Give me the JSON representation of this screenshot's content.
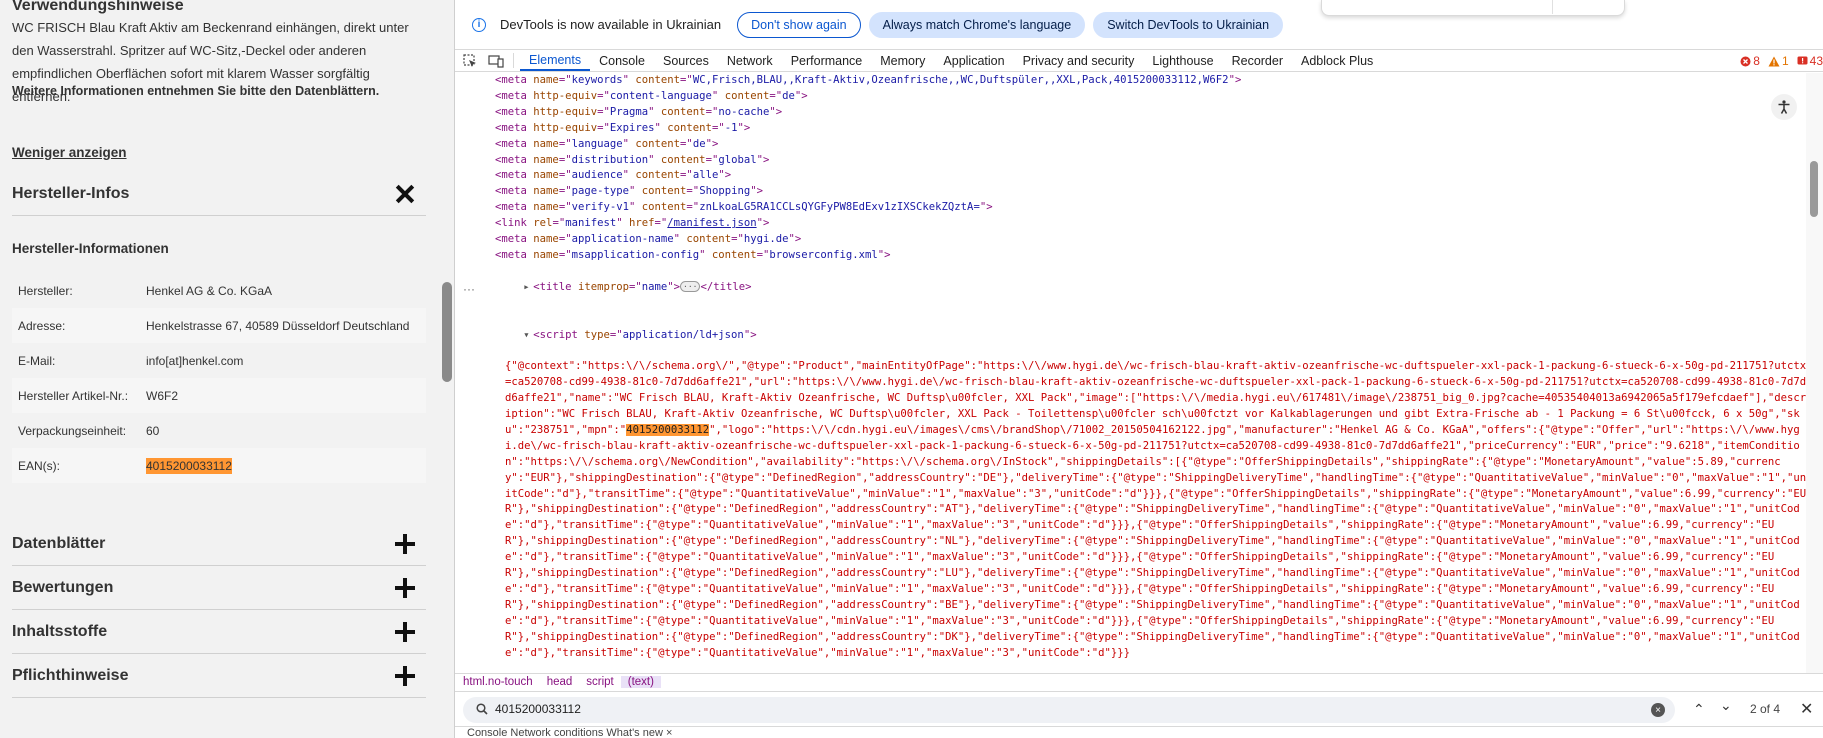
{
  "page": {
    "usage_heading": "Verwendungshinweise",
    "usage_text": "WC FRISCH Blau Kraft Aktiv am Beckenrand einhängen, direkt unter den Wasserstrahl. Spritzer auf WC-Sitz,-Deckel oder anderen empfindlichen Oberflächen sofort mit klarem Wasser sorgfältig entfernen.",
    "datasheet_note": "Weitere Informationen entnehmen Sie bitte den Datenblättern.",
    "show_less": "Weniger anzeigen",
    "manufacturer_section": "Hersteller-Infos",
    "manufacturer_subheading": "Hersteller-Informationen",
    "rows": [
      {
        "key": "Hersteller:",
        "value": "Henkel AG & Co. KGaA"
      },
      {
        "key": "Adresse:",
        "value": "Henkelstrasse 67, 40589 Düsseldorf Deutschland"
      },
      {
        "key": "E-Mail:",
        "value": "info[at]henkel.com"
      },
      {
        "key": "Hersteller Artikel-Nr.:",
        "value": "W6F2"
      },
      {
        "key": "Verpackungseinheit:",
        "value": "60"
      },
      {
        "key": "EAN(s):",
        "value": "4015200033112"
      }
    ],
    "accordions": [
      "Datenblätter",
      "Bewertungen",
      "Inhaltsstoffe",
      "Pflichthinweise"
    ]
  },
  "devtools": {
    "info_text": "DevTools is now available in Ukrainian",
    "btn_dont_show": "Don't show again",
    "btn_match": "Always match Chrome's language",
    "btn_switch": "Switch DevTools to Ukrainian",
    "tabs": [
      "Elements",
      "Console",
      "Sources",
      "Network",
      "Performance",
      "Memory",
      "Application",
      "Privacy and security",
      "Lighthouse",
      "Recorder",
      "Adblock Plus"
    ],
    "errors": "8",
    "warnings": "1",
    "issues": "43",
    "crumbs": [
      "html.no-touch",
      "head",
      "script",
      "(text)"
    ],
    "search_query": "4015200033112",
    "search_count": "2 of 4",
    "below_text": "Console   Network conditions   What's new  ×",
    "json": {
      "part1": "{\"@context\":\"https:\\/\\/schema.org\\/\",\"@type\":\"Product\",\"mainEntityOfPage\":\"https:\\/\\/www.hygi.de\\/wc-frisch-blau-kraft-aktiv-ozeanfrische-wc-duftspueler-xxl-pack-1-packung-6-stueck-6-x-50g-pd-211751?utctx=ca520708-cd99-4938-81c0-7d7dd6affe21\",\"url\":\"https:\\/\\/www.hygi.de\\/wc-frisch-blau-kraft-aktiv-ozeanfrische-wc-duftspueler-xxl-pack-1-packung-6-stueck-6-x-50g-pd-211751?utctx=ca520708-cd99-4938-81c0-7d7dd6affe21\",\"name\":\"WC Frisch BLAU, Kraft-Aktiv Ozeanfrische, WC Duftsp\\u00fcler, XXL Pack\",\"image\":[\"https:\\/\\/media.hygi.eu\\/617481\\/image\\/238751_big_0.jpg?cache=40535404013a6942065a5f179efcdaef\"],\"description\":\"WC Frisch BLAU, Kraft-Aktiv Ozeanfrische, WC Duftsp\\u00fcler, XXL Pack - Toilettensp\\u00fcler sch\\u00fctzt vor Kalkablagerungen und gibt Extra-Frische ab - 1 Packung = 6 St\\u00fcck, 6 x 50g\",\"sku\":\"238751\",\"mpn\":\"",
      "mpn": "4015200033112",
      "part2": "\",\"logo\":\"https:\\/\\/cdn.hygi.eu\\/images\\/cms\\/brandShop\\/71002_20150504162122.jpg\",\"manufacturer\":\"Henkel AG & Co. KGaA\",\"offers\":{\"@type\":\"Offer\",\"url\":\"https:\\/\\/www.hygi.de\\/wc-frisch-blau-kraft-aktiv-ozeanfrische-wc-duftspueler-xxl-pack-1-packung-6-stueck-6-x-50g-pd-211751?utctx=ca520708-cd99-4938-81c0-7d7dd6affe21\",\"priceCurrency\":\"EUR\",\"price\":\"9.6218\",\"itemCondition\":\"https:\\/\\/schema.org\\/NewCondition\",\"availability\":\"https:\\/\\/schema.org\\/InStock\",\"shippingDetails\":[{\"@type\":\"OfferShippingDetails\",\"shippingRate\":{\"@type\":\"MonetaryAmount\",\"value\":5.89,\"currency\":\"EUR\"},\"shippingDestination\":{\"@type\":\"DefinedRegion\",\"addressCountry\":\"DE\"},\"deliveryTime\":{\"@type\":\"ShippingDeliveryTime\",\"handlingTime\":{\"@type\":\"QuantitativeValue\",\"minValue\":\"0\",\"maxValue\":\"1\",\"unitCode\":\"d\"},\"transitTime\":{\"@type\":\"QuantitativeValue\",\"minValue\":\"1\",\"maxValue\":\"3\",\"unitCode\":\"d\"}}},{\"@type\":\"OfferShippingDetails\",\"shippingRate\":{\"@type\":\"MonetaryAmount\",\"value\":6.99,\"currency\":\"EUR\"},\"shippingDestination\":{\"@type\":\"DefinedRegion\",\"addressCountry\":\"AT\"},\"deliveryTime\":{\"@type\":\"ShippingDeliveryTime\",\"handlingTime\":{\"@type\":\"QuantitativeValue\",\"minValue\":\"0\",\"maxValue\":\"1\",\"unitCode\":\"d\"},\"transitTime\":{\"@type\":\"QuantitativeValue\",\"minValue\":\"1\",\"maxValue\":\"3\",\"unitCode\":\"d\"}}},{\"@type\":\"OfferShippingDetails\",\"shippingRate\":{\"@type\":\"MonetaryAmount\",\"value\":6.99,\"currency\":\"EUR\"},\"shippingDestination\":{\"@type\":\"DefinedRegion\",\"addressCountry\":\"NL\"},\"deliveryTime\":{\"@type\":\"ShippingDeliveryTime\",\"handlingTime\":{\"@type\":\"QuantitativeValue\",\"minValue\":\"0\",\"maxValue\":\"1\",\"unitCode\":\"d\"},\"transitTime\":{\"@type\":\"QuantitativeValue\",\"minValue\":\"1\",\"maxValue\":\"3\",\"unitCode\":\"d\"}}},{\"@type\":\"OfferShippingDetails\",\"shippingRate\":{\"@type\":\"MonetaryAmount\",\"value\":6.99,\"currency\":\"EUR\"},\"shippingDestination\":{\"@type\":\"DefinedRegion\",\"addressCountry\":\"LU\"},\"deliveryTime\":{\"@type\":\"ShippingDeliveryTime\",\"handlingTime\":{\"@type\":\"QuantitativeValue\",\"minValue\":\"0\",\"maxValue\":\"1\",\"unitCode\":\"d\"},\"transitTime\":{\"@type\":\"QuantitativeValue\",\"minValue\":\"1\",\"maxValue\":\"3\",\"unitCode\":\"d\"}}},{\"@type\":\"OfferShippingDetails\",\"shippingRate\":{\"@type\":\"MonetaryAmount\",\"value\":6.99,\"currency\":\"EUR\"},\"shippingDestination\":{\"@type\":\"DefinedRegion\",\"addressCountry\":\"BE\"},\"deliveryTime\":{\"@type\":\"ShippingDeliveryTime\",\"handlingTime\":{\"@type\":\"QuantitativeValue\",\"minValue\":\"0\",\"maxValue\":\"1\",\"unitCode\":\"d\"},\"transitTime\":{\"@type\":\"QuantitativeValue\",\"minValue\":\"1\",\"maxValue\":\"3\",\"unitCode\":\"d\"}}},{\"@type\":\"OfferShippingDetails\",\"shippingRate\":{\"@type\":\"MonetaryAmount\",\"value\":6.99,\"currency\":\"EUR\"},\"shippingDestination\":{\"@type\":\"DefinedRegion\",\"addressCountry\":\"DK\"},\"deliveryTime\":{\"@type\":\"ShippingDeliveryTime\",\"handlingTime\":{\"@type\":\"QuantitativeValue\",\"minValue\":\"0\",\"maxValue\":\"1\",\"unitCode\":\"d\"},\"transitTime\":{\"@type\":\"QuantitativeValue\",\"minValue\":\"1\",\"maxValue\":\"3\",\"unitCode\":\"d\"}}}"
    },
    "lines": [
      {
        "tag": "meta",
        "attrs": [
          [
            "name",
            "keywords"
          ],
          [
            "content",
            "WC,Frisch,BLAU,,Kraft-Aktiv,Ozeanfrische,,WC,Duftspüler,,XXL,Pack,4015200033112,W6F2"
          ]
        ]
      },
      {
        "tag": "meta",
        "attrs": [
          [
            "http-equiv",
            "content-language"
          ],
          [
            "content",
            "de"
          ]
        ]
      },
      {
        "tag": "meta",
        "attrs": [
          [
            "http-equiv",
            "Pragma"
          ],
          [
            "content",
            "no-cache"
          ]
        ]
      },
      {
        "tag": "meta",
        "attrs": [
          [
            "http-equiv",
            "Expires"
          ],
          [
            "content",
            "-1"
          ]
        ]
      },
      {
        "tag": "meta",
        "attrs": [
          [
            "name",
            "language"
          ],
          [
            "content",
            "de"
          ]
        ]
      },
      {
        "tag": "meta",
        "attrs": [
          [
            "name",
            "distribution"
          ],
          [
            "content",
            "global"
          ]
        ]
      },
      {
        "tag": "meta",
        "attrs": [
          [
            "name",
            "audience"
          ],
          [
            "content",
            "alle"
          ]
        ]
      },
      {
        "tag": "meta",
        "attrs": [
          [
            "name",
            "page-type"
          ],
          [
            "content",
            "Shopping"
          ]
        ]
      },
      {
        "tag": "meta",
        "attrs": [
          [
            "name",
            "verify-v1"
          ],
          [
            "content",
            "znLkoaLG5RA1CCLsQYGFyPW8EdExv1zIXSCkekZQztA="
          ]
        ]
      },
      {
        "tag": "link",
        "attrs": [
          [
            "rel",
            "manifest"
          ],
          [
            "href",
            "/manifest.json"
          ]
        ]
      },
      {
        "tag": "meta",
        "attrs": [
          [
            "name",
            "application-name"
          ],
          [
            "content",
            "hygi.de"
          ]
        ]
      },
      {
        "tag": "meta",
        "attrs": [
          [
            "name",
            "msapplication-config"
          ],
          [
            "content",
            "browserconfig.xml"
          ]
        ]
      }
    ],
    "title_line": {
      "tag": "title",
      "attr_name": "itemprop",
      "attr_value": "name"
    },
    "script_line": {
      "tag": "script",
      "attr_name": "type",
      "attr_value": "application/ld+json"
    }
  },
  "colors": {
    "highlight": "#ff9632",
    "accent": "#0b57d0",
    "error": "#d93025",
    "warning": "#e37400"
  }
}
